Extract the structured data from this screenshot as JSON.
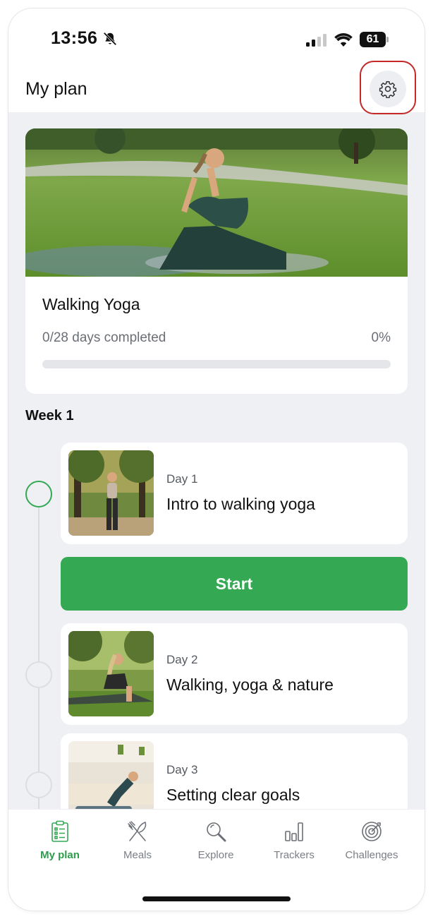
{
  "status_bar": {
    "time": "13:56",
    "battery": "61"
  },
  "header": {
    "title": "My plan",
    "settings_icon": "gear-icon"
  },
  "plan": {
    "name": "Walking Yoga",
    "progress_text": "0/28 days completed",
    "percent_text": "0%",
    "progress_fraction": 0
  },
  "week": {
    "label": "Week 1"
  },
  "days": [
    {
      "label": "Day 1",
      "title": "Intro to walking yoga",
      "status": "current"
    },
    {
      "label": "Day 2",
      "title": "Walking, yoga & nature",
      "status": "upcoming"
    },
    {
      "label": "Day 3",
      "title": "Setting clear goals",
      "status": "upcoming"
    }
  ],
  "start_button": {
    "label": "Start"
  },
  "bottom_nav": [
    {
      "label": "My plan",
      "icon": "clipboard-icon",
      "active": true
    },
    {
      "label": "Meals",
      "icon": "fork-knife-icon",
      "active": false
    },
    {
      "label": "Explore",
      "icon": "magnifier-icon",
      "active": false
    },
    {
      "label": "Trackers",
      "icon": "bar-chart-icon",
      "active": false
    },
    {
      "label": "Challenges",
      "icon": "target-icon",
      "active": false
    }
  ],
  "colors": {
    "accent": "#34a853",
    "highlight_outline": "#c62828",
    "background": "#eef0f3"
  }
}
